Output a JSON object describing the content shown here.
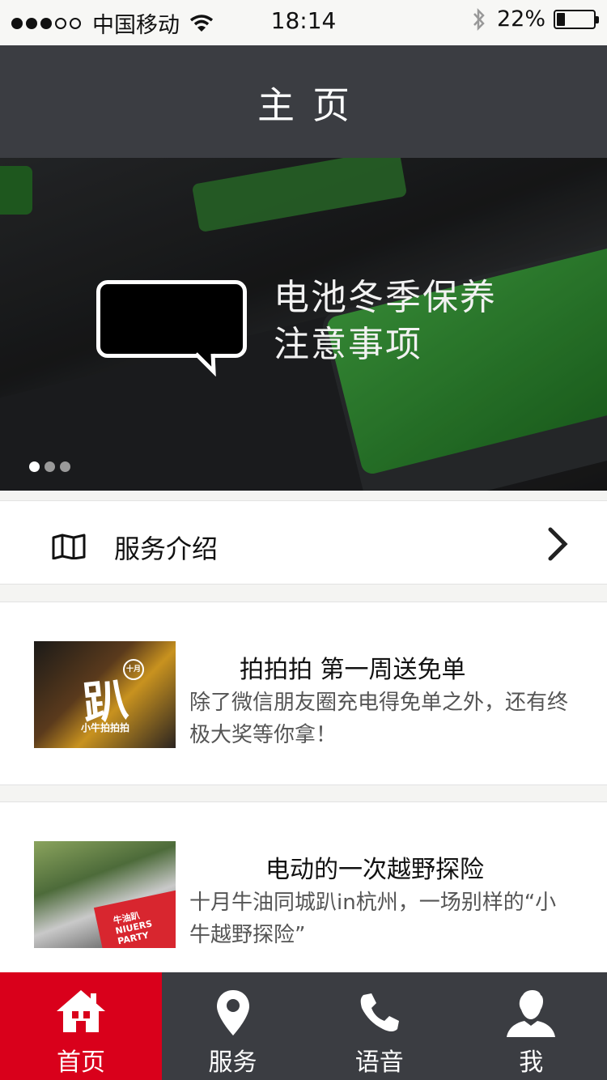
{
  "status_bar": {
    "carrier": "中国移动",
    "time": "18:14",
    "battery_percent": "22%",
    "battery_level": 0.22,
    "signal_bars_filled": 3,
    "signal_bars_total": 5
  },
  "header": {
    "title": "主页"
  },
  "banner": {
    "line1": "电池冬季保养",
    "line2": "注意事项",
    "page_count": 3,
    "active_page": 1
  },
  "service_entry": {
    "icon": "map-icon",
    "label": "服务介绍",
    "chevron": "chevron-right-icon"
  },
  "articles": [
    {
      "title": "拍拍拍 第一周送免单",
      "desc": "除了微信朋友圈充电得免单之外，还有终极大奖等你拿！",
      "thumb_text": "趴",
      "thumb_badge": "十月",
      "thumb_caption": "小牛拍拍拍"
    },
    {
      "title": "电动的一次越野探险",
      "desc": "十月牛油同城趴in杭州，一场别样的“小牛越野探险”",
      "thumb_flag": "牛油趴 NIUERS PARTY"
    }
  ],
  "tabbar": {
    "items": [
      {
        "label": "首页",
        "icon": "home-icon",
        "active": true
      },
      {
        "label": "服务",
        "icon": "location-pin-icon",
        "active": false
      },
      {
        "label": "语音",
        "icon": "phone-icon",
        "active": false
      },
      {
        "label": "我",
        "icon": "user-icon",
        "active": false
      }
    ]
  },
  "colors": {
    "nav_bg": "#3b3d42",
    "accent_red": "#d9001b",
    "page_bg": "#f4f4f2"
  }
}
